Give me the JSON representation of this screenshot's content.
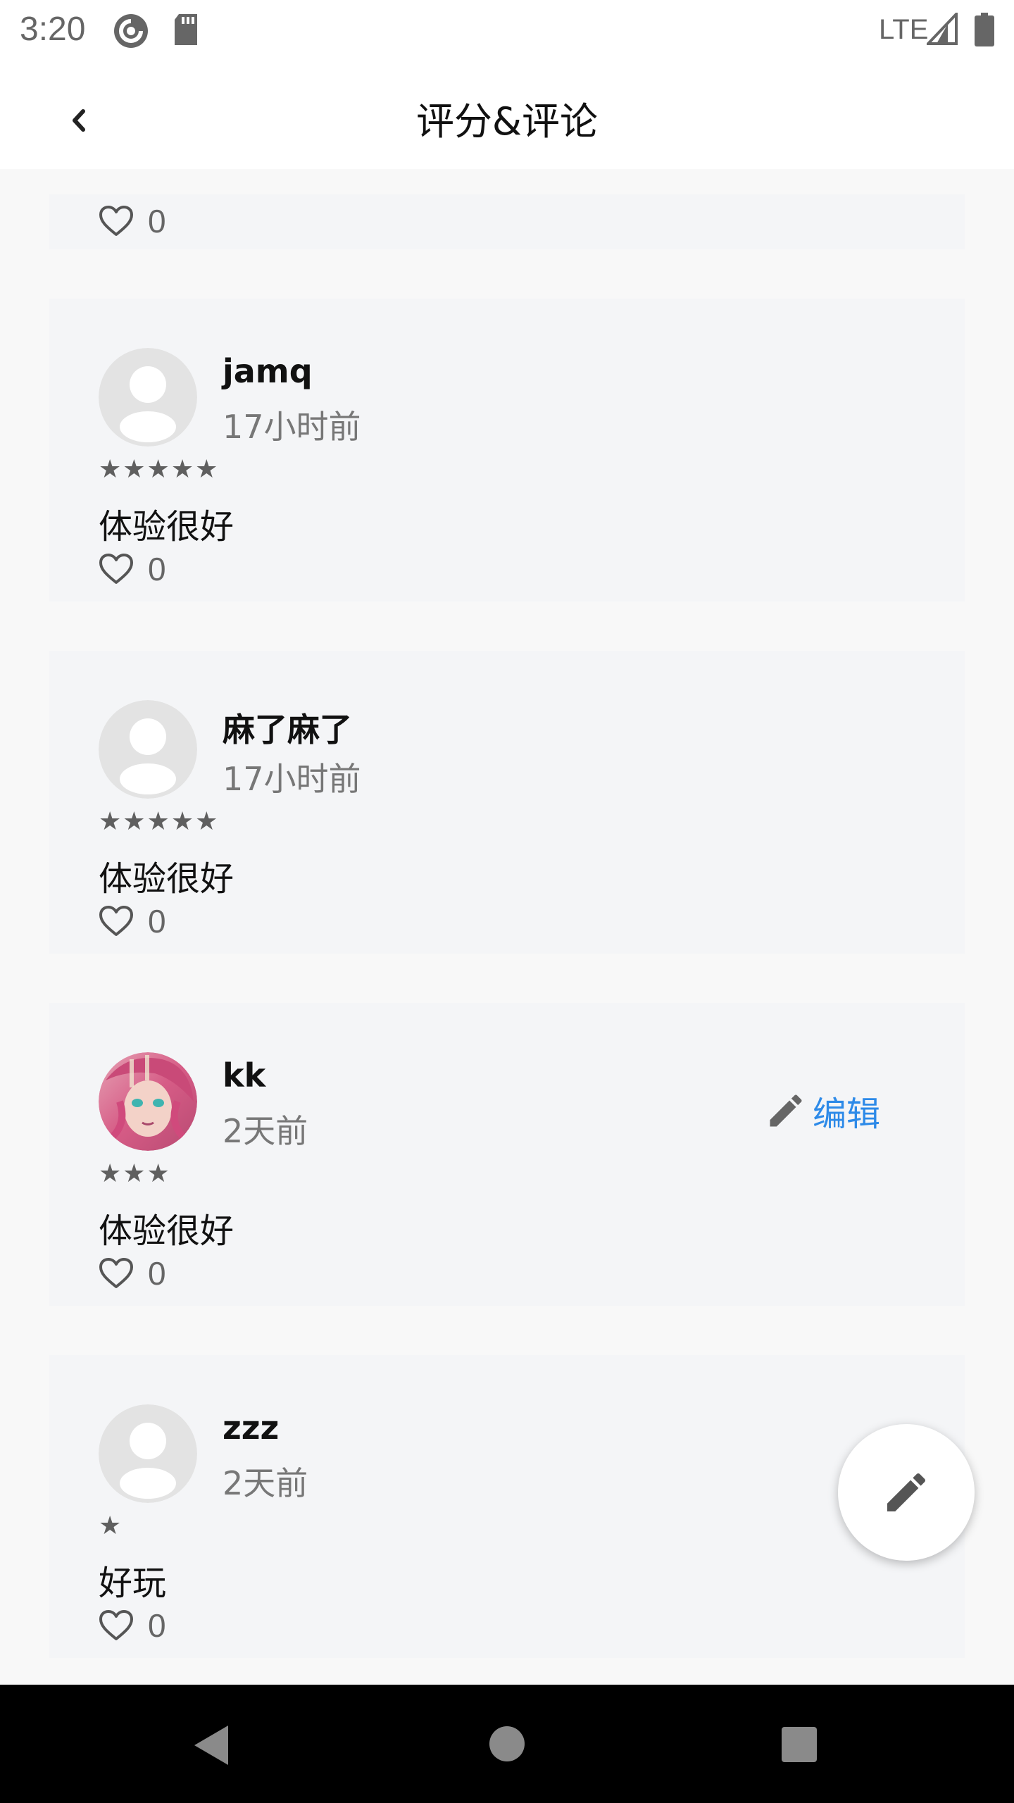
{
  "status_bar": {
    "time": "3:20",
    "network": "LTE",
    "icons": [
      "pocket-casts-icon",
      "sd-card-icon",
      "signal-icon",
      "battery-icon"
    ]
  },
  "header": {
    "title": "评分&评论",
    "back_icon": "chevron-left-icon"
  },
  "reviews": [
    {
      "likes": "0"
    },
    {
      "username": "jamq",
      "time": "17小时前",
      "stars": "★★★★★",
      "rating": 5,
      "text": "体验很好",
      "likes": "0",
      "avatar": "default-avatar-icon"
    },
    {
      "username": "麻了麻了",
      "time": "17小时前",
      "stars": "★★★★★",
      "rating": 5,
      "text": "体验很好",
      "likes": "0",
      "avatar": "default-avatar-icon"
    },
    {
      "username": "kk",
      "time": "2天前",
      "stars": "★★★",
      "rating": 3,
      "text": "体验很好",
      "likes": "0",
      "avatar": "anime-avatar-image",
      "edit_label": "编辑"
    },
    {
      "username": "zzz",
      "time": "2天前",
      "stars": "★",
      "rating": 1,
      "text": "好玩",
      "likes": "0",
      "avatar": "default-avatar-icon"
    }
  ],
  "fab": {
    "icon": "pencil-icon"
  },
  "nav_bar": {
    "icons": [
      "back-triangle-icon",
      "home-circle-icon",
      "recents-square-icon"
    ]
  },
  "colors": {
    "accent": "#2d8ae8",
    "card_bg": "#f4f5f7",
    "page_bg": "#f8f8f8"
  }
}
